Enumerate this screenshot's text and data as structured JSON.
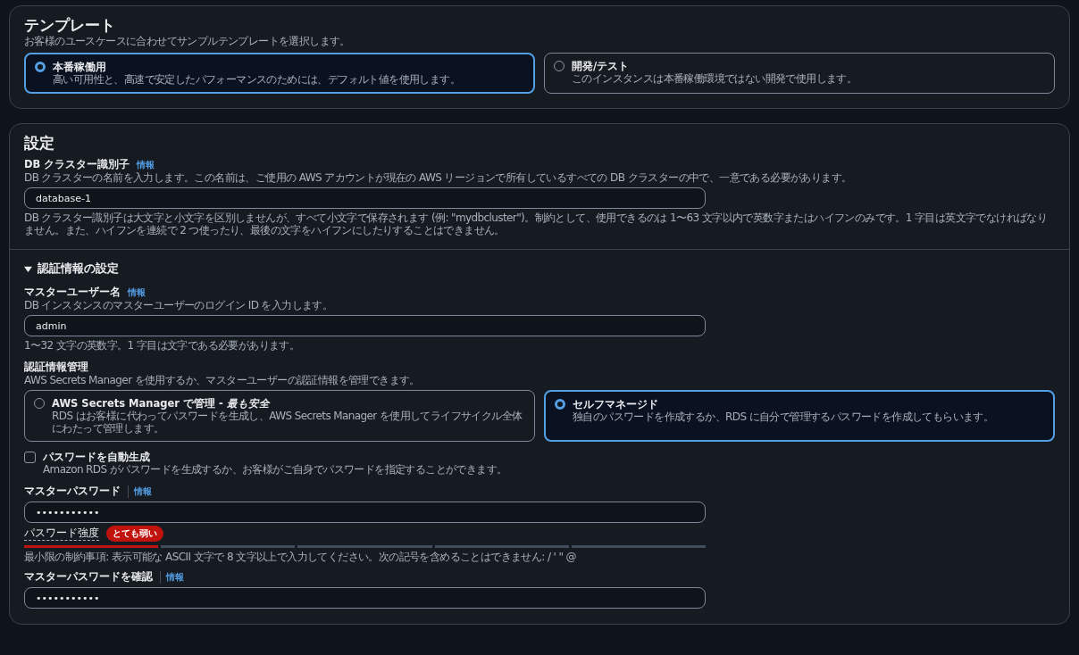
{
  "template": {
    "title": "テンプレート",
    "description": "お客様のユースケースに合わせてサンプルテンプレートを選択します。",
    "options": [
      {
        "label": "本番稼働用",
        "description": "高い可用性と、高速で安定したパフォーマンスのためには、デフォルト値を使用します。",
        "selected": true
      },
      {
        "label": "開発/テスト",
        "description": "このインスタンスは本番稼働環境ではない開発で使用します。",
        "selected": false
      }
    ]
  },
  "settings": {
    "title": "設定",
    "cluster_id": {
      "label": "DB クラスター識別子",
      "info": "情報",
      "info_divider": false,
      "description": "DB クラスターの名前を入力します。この名前は、ご使用の AWS アカウントが現在の AWS リージョンで所有しているすべての DB クラスターの中で、一意である必要があります。",
      "value": "database-1",
      "hint": "DB クラスター識別子は大文字と小文字を区別しませんが、すべて小文字で保存されます (例: \"mydbcluster\")。制約として、使用できるのは 1〜63 文字以内で英数字またはハイフンのみです。1 字目は英文字でなければなりません。また、ハイフンを連続で 2 つ使ったり、最後の文字をハイフンにしたりすることはできません。"
    },
    "credentials": {
      "title": "認証情報の設定",
      "expanded": true,
      "master_username": {
        "label": "マスターユーザー名",
        "info": "情報",
        "info_divider": false,
        "description": "DB インスタンスのマスターユーザーのログイン ID を入力します。",
        "value": "admin",
        "hint": "1〜32 文字の英数字。1 字目は文字である必要があります。"
      },
      "management": {
        "label": "認証情報管理",
        "description": "AWS Secrets Manager を使用するか、マスターユーザーの認証情報を管理できます。",
        "options": [
          {
            "label": "AWS Secrets Manager で管理 - *最も安全*",
            "description": "RDS はお客様に代わってパスワードを生成し、AWS Secrets Manager を使用してライフサイクル全体にわたって管理します。",
            "selected": false
          },
          {
            "label": "セルフマネージド",
            "description": "独自のパスワードを作成するか、RDS に自分で管理するパスワードを作成してもらいます。",
            "selected": true
          }
        ]
      },
      "auto_generate": {
        "label": "パスワードを自動生成",
        "description": "Amazon RDS がパスワードを生成するか、お客様がご自身でパスワードを指定することができます。",
        "checked": false
      },
      "master_password": {
        "label": "マスターパスワード",
        "info": "情報",
        "info_divider": true,
        "value": "•••••••••••"
      },
      "strength": {
        "label": "パスワード強度",
        "badge": "とても弱い",
        "level": 0.2,
        "hint": "最小限の制約事項: 表示可能な ASCII 文字で 8 文字以上で入力してください。次の記号を含めることはできません: / ' \" @"
      },
      "confirm_password": {
        "label": "マスターパスワードを確認",
        "info": "情報",
        "info_divider": true,
        "value": "•••••••••••"
      }
    }
  }
}
